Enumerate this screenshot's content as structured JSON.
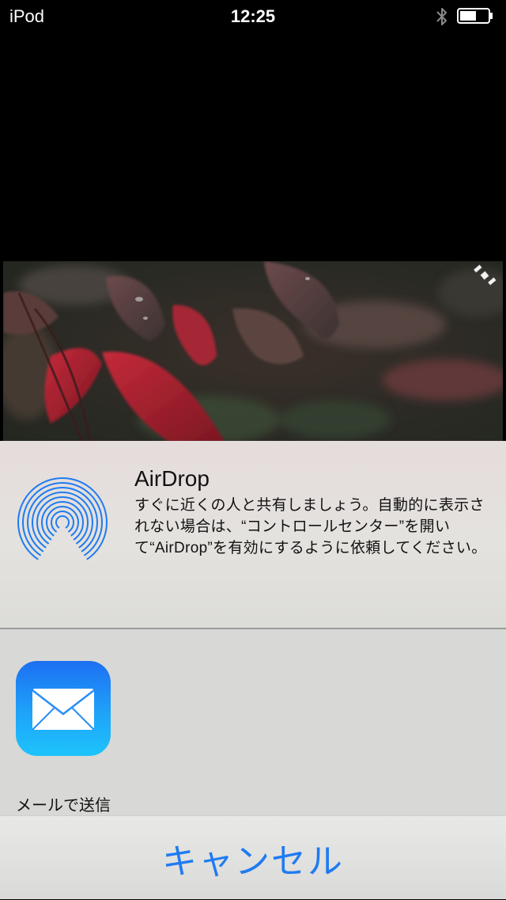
{
  "status_bar": {
    "carrier": "iPod",
    "time": "12:25",
    "bluetooth_icon": "bluetooth-icon",
    "battery_icon": "battery-icon"
  },
  "photo": {
    "description_icon": "satellite-icon"
  },
  "airdrop": {
    "title": "AirDrop",
    "description": "すぐに近くの人と共有しましょう。自動的に表示されない場合は、“コントロールセンター”を開いて“AirDrop”を有効にするように依頼してください。",
    "icon": "airdrop-icon",
    "accent_color": "#1f7bf2"
  },
  "apps": [
    {
      "label": "メールで送信",
      "icon": "mail-icon"
    }
  ],
  "cancel": {
    "label": "キャンセル",
    "color": "#1f7bf2"
  }
}
